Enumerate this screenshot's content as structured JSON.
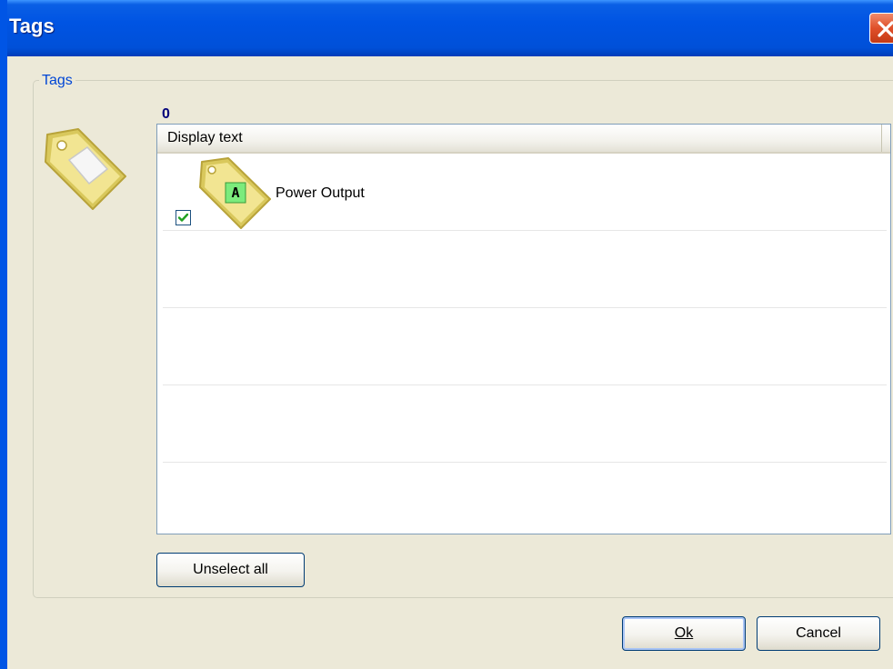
{
  "window": {
    "title": "Tags"
  },
  "group": {
    "legend": "Tags",
    "count": "0"
  },
  "list": {
    "column_header": "Display text",
    "rows": [
      {
        "label": "Power Output",
        "badge": "A",
        "checked": true
      }
    ]
  },
  "buttons": {
    "unselect_all": "Unselect all",
    "ok": "Ok",
    "cancel": "Cancel"
  },
  "colors": {
    "titlebar": "#0054E3",
    "dialog_bg": "#ECE9D8",
    "legend_text": "#0046D5",
    "count_text": "#00007A",
    "tag_gold": "#E8D570",
    "badge_green": "#7CEB7C",
    "close_red": "#E0502A"
  },
  "icons": {
    "close": "close-x-icon",
    "group_tag": "tag-icon",
    "row_tag": "tag-with-badge-icon",
    "check": "check-icon"
  }
}
